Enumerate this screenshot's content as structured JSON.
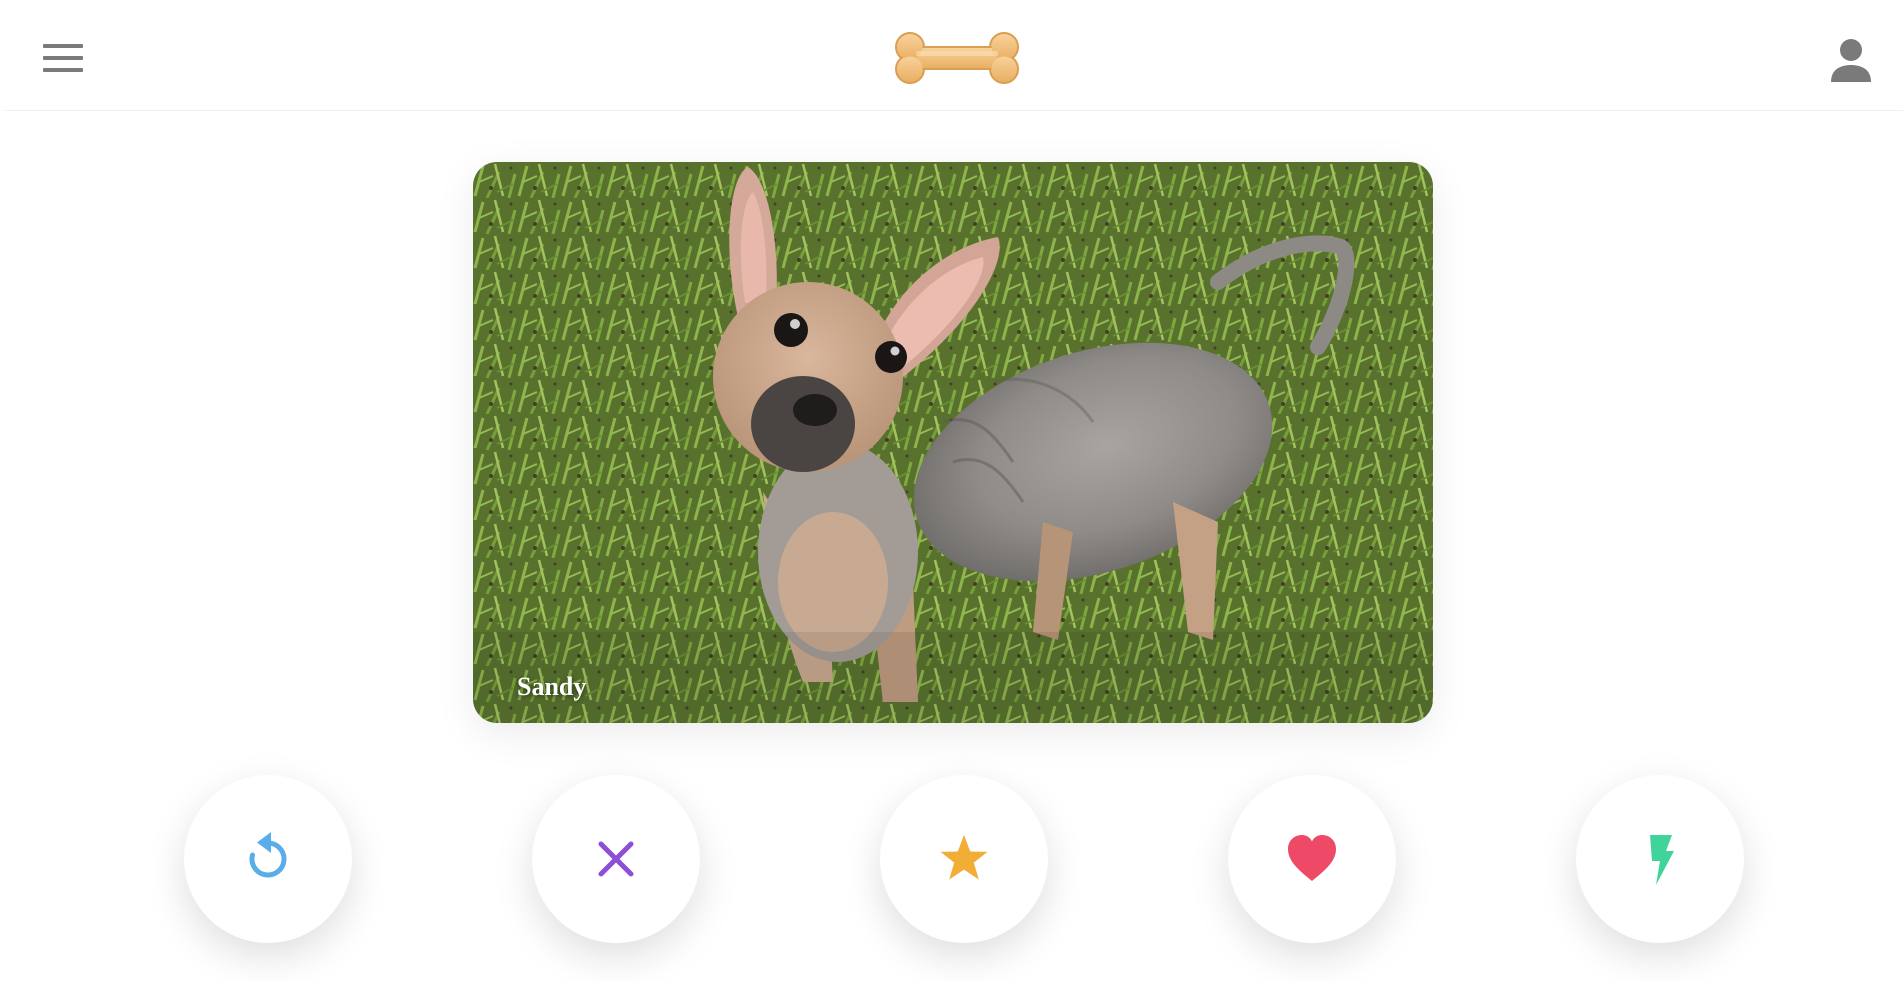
{
  "header": {
    "menu_icon": "hamburger-menu-icon",
    "logo_icon": "bone-logo-icon",
    "profile_icon": "person-icon"
  },
  "card": {
    "name": "Sandy"
  },
  "actions": [
    {
      "id": "rewind",
      "icon": "rewind-icon",
      "color": "#5aade8"
    },
    {
      "id": "nope",
      "icon": "close-icon",
      "color": "#8c4fd6"
    },
    {
      "id": "super-like",
      "icon": "star-icon",
      "color": "#f2ad37"
    },
    {
      "id": "like",
      "icon": "heart-icon",
      "color": "#ee4a67"
    },
    {
      "id": "boost",
      "icon": "lightning-icon",
      "color": "#3fd49a"
    }
  ],
  "colors": {
    "logo": "#f5c47c",
    "header_icons": "#7a7a7a"
  }
}
